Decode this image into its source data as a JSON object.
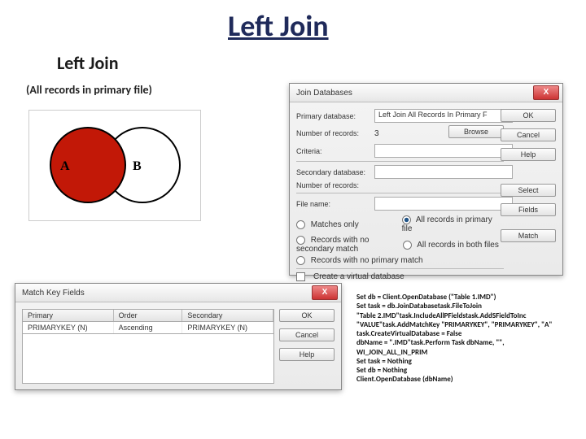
{
  "title": "Left Join",
  "subtitle": "Left Join",
  "tagline": "(All records in primary file)",
  "venn": {
    "labelA": "A",
    "labelB": "B"
  },
  "join_dialog": {
    "title": "Join Databases",
    "close": "X",
    "primary_label": "Primary database:",
    "primary_value": "Left Join  All Records In Primary F",
    "records_label": "Number of records:",
    "records_value": "3",
    "criteria_label": "Criteria:",
    "secondary_label": "Secondary database:",
    "secondary_records_label": "Number of records:",
    "filename_label": "File name:",
    "opt_matches_only": "Matches only",
    "opt_all_primary": "All records in primary file",
    "opt_no_secondary": "Records with no secondary match",
    "opt_all_both": "All records in both files",
    "opt_no_primary": "Records with no primary match",
    "chk_virtual": "Create a virtual database",
    "buttons": {
      "ok": "OK",
      "cancel": "Cancel",
      "help": "Help",
      "browse": "Browse",
      "select": "Select",
      "fields": "Fields",
      "match": "Match"
    }
  },
  "match_dialog": {
    "title": "Match Key Fields",
    "close": "X",
    "cols": {
      "primary": "Primary",
      "order": "Order",
      "secondary": "Secondary"
    },
    "row": {
      "primary": "PRIMARYKEY (N)",
      "order": "Ascending",
      "secondary": "PRIMARYKEY (N)"
    },
    "buttons": {
      "ok": "OK",
      "cancel": "Cancel",
      "help": "Help"
    }
  },
  "code": {
    "l1": "Set db = Client.OpenDatabase (\"Table 1.IMD\")",
    "l2": "Set task = db.JoinDatabasetask.FileToJoin",
    "l3": "\"Table 2.IMD\"task.IncludeAllPFieldstask.AddSFieldToInc",
    "l4": "\"VALUE\"task.AddMatchKey \"PRIMARYKEY\", \"PRIMARYKEY\", \"A\"",
    "l5": "task.CreateVirtualDatabase = False",
    "l6": "dbName = \".IMD\"task.Perform Task dbName, \"\",",
    "l7": "WI_JOIN_ALL_IN_PRIM",
    "l8": "Set task = Nothing",
    "l9": "Set db = Nothing",
    "l10": "Client.OpenDatabase (dbName)"
  }
}
